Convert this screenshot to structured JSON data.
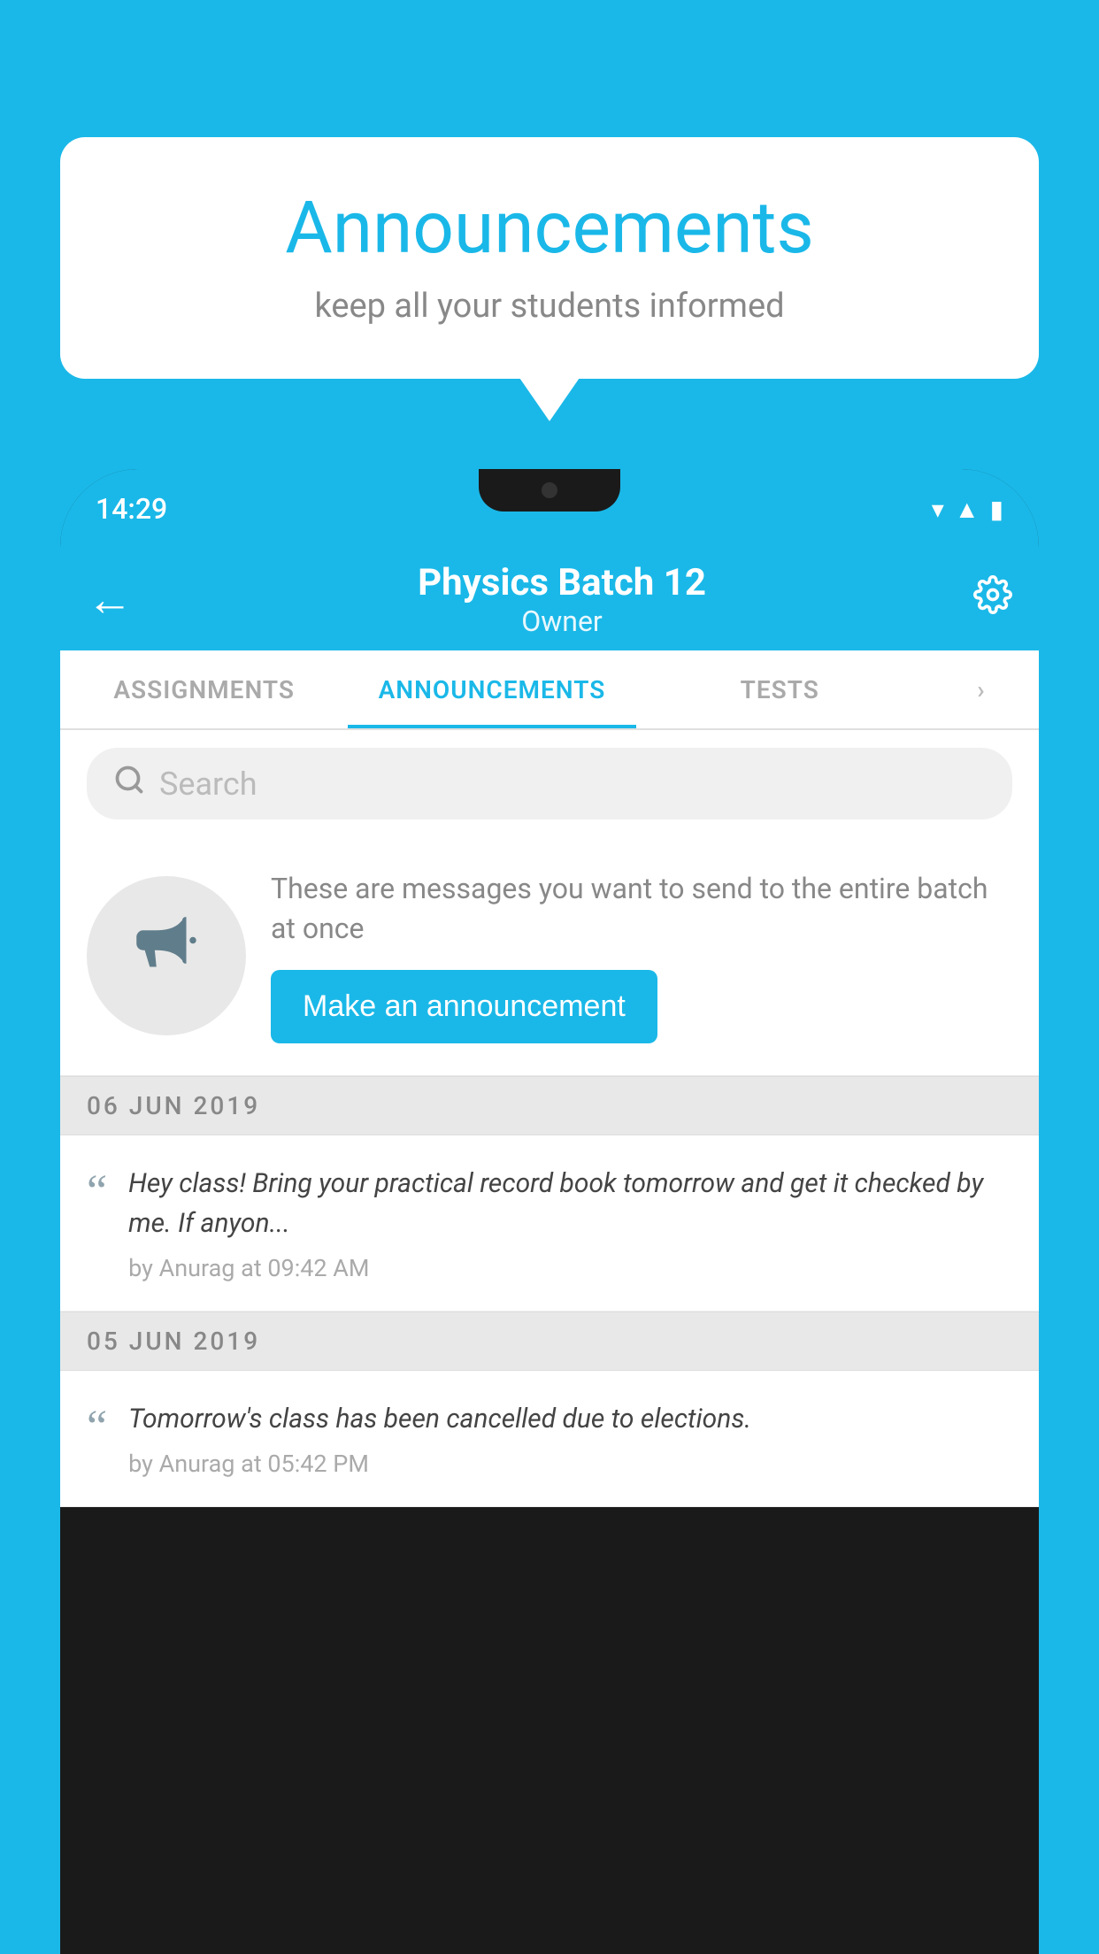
{
  "background_color": "#1ab8e8",
  "speech_bubble": {
    "title": "Announcements",
    "subtitle": "keep all your students informed"
  },
  "phone": {
    "status_bar": {
      "time": "14:29"
    },
    "app_bar": {
      "title": "Physics Batch 12",
      "subtitle": "Owner",
      "back_label": "←",
      "settings_label": "⚙"
    },
    "tabs": [
      {
        "label": "ASSIGNMENTS",
        "active": false
      },
      {
        "label": "ANNOUNCEMENTS",
        "active": true
      },
      {
        "label": "TESTS",
        "active": false
      }
    ],
    "search": {
      "placeholder": "Search"
    },
    "promo": {
      "description": "These are messages you want to send to the entire batch at once",
      "button_label": "Make an announcement"
    },
    "date_groups": [
      {
        "date": "06  JUN  2019",
        "announcements": [
          {
            "text": "Hey class! Bring your practical record book tomorrow and get it checked by me. If anyon...",
            "meta": "by Anurag at 09:42 AM"
          }
        ]
      },
      {
        "date": "05  JUN  2019",
        "announcements": [
          {
            "text": "Tomorrow's class has been cancelled due to elections.",
            "meta": "by Anurag at 05:42 PM"
          }
        ]
      }
    ]
  }
}
